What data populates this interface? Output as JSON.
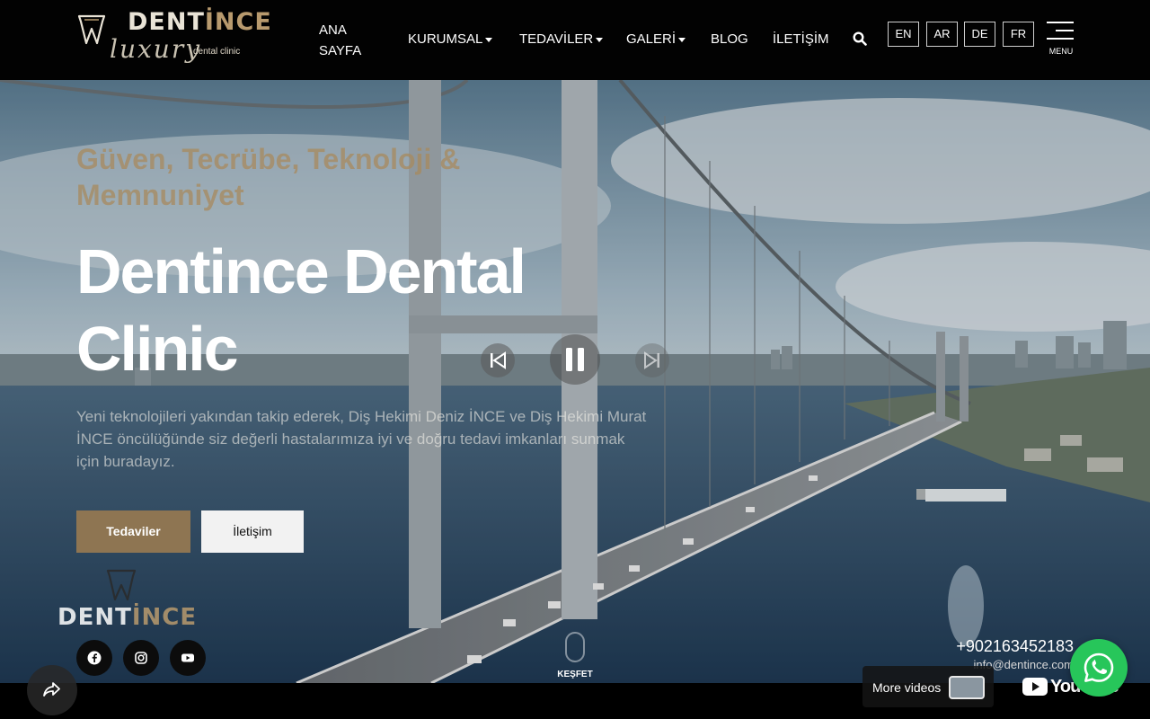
{
  "brand": {
    "name_part1": "DENT",
    "name_part2": "İNCE",
    "script": "luxury",
    "subtitle": "dental clinic"
  },
  "nav": {
    "items": [
      {
        "label": "ANA SAYFA",
        "dropdown": false
      },
      {
        "label": "KURUMSAL",
        "dropdown": true
      },
      {
        "label": "TEDAVİLER",
        "dropdown": true
      },
      {
        "label": "GALERİ",
        "dropdown": true
      },
      {
        "label": "BLOG",
        "dropdown": false
      },
      {
        "label": "İLETİŞİM",
        "dropdown": false
      }
    ],
    "search_icon": "search-icon",
    "languages": [
      "EN",
      "AR",
      "DE",
      "FR"
    ],
    "menu_label": "MENU"
  },
  "hero": {
    "tagline": "Güven, Tecrübe, Teknoloji & Memnuniyet",
    "title": "Dentince Dental Clinic",
    "description": "Yeni teknolojileri yakından takip ederek, Diş Hekimi Deniz İNCE ve Diş Hekimi Murat İNCE öncülüğünde siz değerli hastalarımıza iyi ve doğru tedavi imkanları sunmak için buradayız.",
    "primary_button": "Tedaviler",
    "secondary_button": "İletişim",
    "explore_label": "KEŞFET",
    "video_controls": [
      "previous-icon",
      "pause-icon",
      "next-icon"
    ]
  },
  "footer_overlay": {
    "social": [
      "facebook-icon",
      "instagram-icon",
      "youtube-icon"
    ],
    "phone": "+902163452183",
    "email": "info@dentince.com"
  },
  "video_bar": {
    "more_videos": "More videos",
    "youtube_word": "YouTube"
  },
  "colors": {
    "accent": "#8e7552",
    "header_bg": "#020202",
    "whatsapp": "#27c65a"
  }
}
